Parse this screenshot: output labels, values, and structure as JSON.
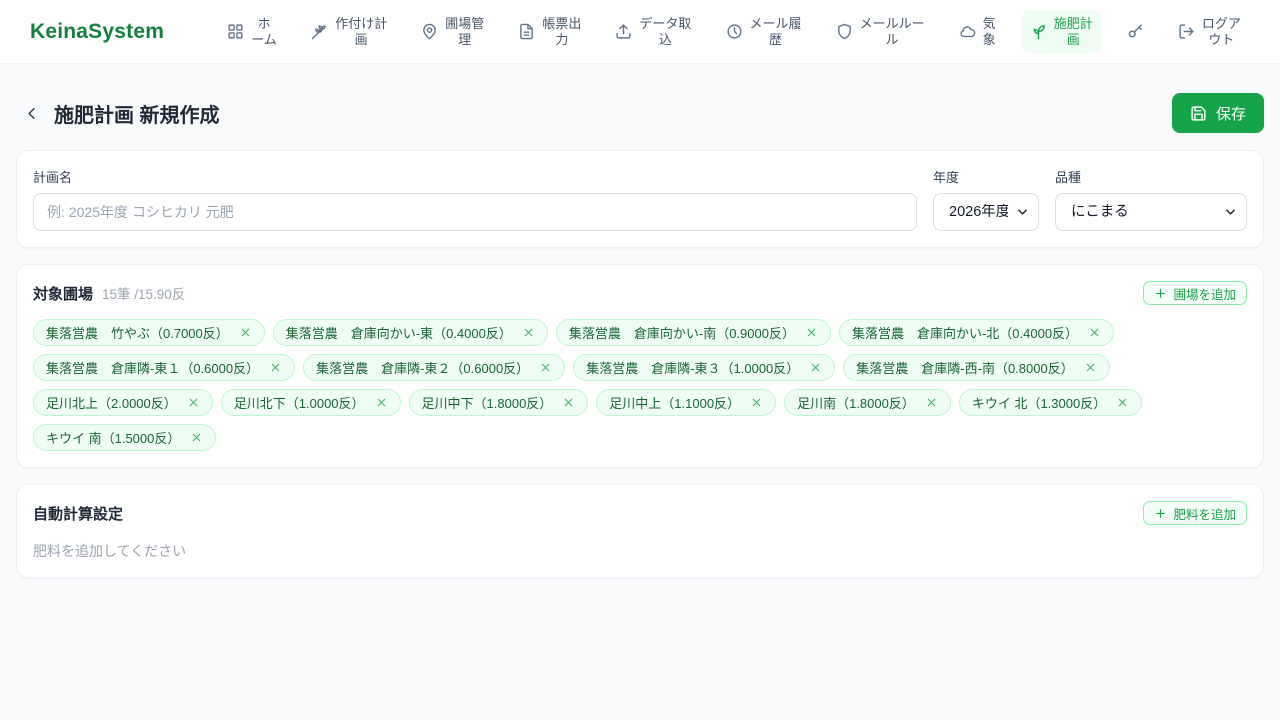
{
  "brand": "KeinaSystem",
  "colors": {
    "brand_green": "#15803d",
    "accent_green": "#16a34a",
    "active_nav_bg": "#f0fdf4",
    "chip_bg": "#f0fdf4",
    "chip_border": "#bbf7d0",
    "chip_text": "#166534",
    "page_bg": "#f8fafc"
  },
  "nav": {
    "items": [
      {
        "id": "home",
        "icon": "grid",
        "label": "ホーム",
        "active": false
      },
      {
        "id": "planting-plan",
        "icon": "wheat",
        "label": "作付け計画",
        "active": false
      },
      {
        "id": "field-management",
        "icon": "pin",
        "label": "圃場管理",
        "active": false
      },
      {
        "id": "report-output",
        "icon": "doc",
        "label": "帳票出力",
        "active": false
      },
      {
        "id": "data-import",
        "icon": "upload",
        "label": "データ取込",
        "active": false
      },
      {
        "id": "mail-history",
        "icon": "history",
        "label": "メール履歴",
        "active": false
      },
      {
        "id": "mail-rules",
        "icon": "shield",
        "label": "メールルール",
        "active": false
      },
      {
        "id": "weather",
        "icon": "cloud",
        "label": "気象",
        "active": false
      },
      {
        "id": "fertilization-plan",
        "icon": "sprout",
        "label": "施肥計画",
        "active": true
      },
      {
        "id": "password",
        "icon": "key",
        "label": "",
        "active": false
      },
      {
        "id": "logout",
        "icon": "logout",
        "label": "ログアウト",
        "active": false
      }
    ]
  },
  "header": {
    "title": "施肥計画 新規作成",
    "save_label": "保存"
  },
  "form": {
    "plan_name": {
      "label": "計画名",
      "value": "",
      "placeholder": "例: 2025年度 コシヒカリ 元肥"
    },
    "year": {
      "label": "年度",
      "value": "2026年度"
    },
    "variety": {
      "label": "品種",
      "value": "にこまる"
    }
  },
  "fields_section": {
    "title": "対象圃場",
    "summary": "15筆 /15.90反",
    "add_button": "圃場を追加",
    "chips": [
      "集落営農　竹やぶ（0.7000反）",
      "集落営農　倉庫向かい-東（0.4000反）",
      "集落営農　倉庫向かい-南（0.9000反）",
      "集落営農　倉庫向かい-北（0.4000反）",
      "集落営農　倉庫隣-東１（0.6000反）",
      "集落営農　倉庫隣-東２（0.6000反）",
      "集落営農　倉庫隣-東３（1.0000反）",
      "集落営農　倉庫隣-西-南（0.8000反）",
      "足川北上（2.0000反）",
      "足川北下（1.0000反）",
      "足川中下（1.8000反）",
      "足川中上（1.1000反）",
      "足川南（1.8000反）",
      "キウイ 北（1.3000反）",
      "キウイ 南（1.5000反）"
    ]
  },
  "calc_section": {
    "title": "自動計算設定",
    "add_button": "肥料を追加",
    "empty_text": "肥料を追加してください"
  }
}
